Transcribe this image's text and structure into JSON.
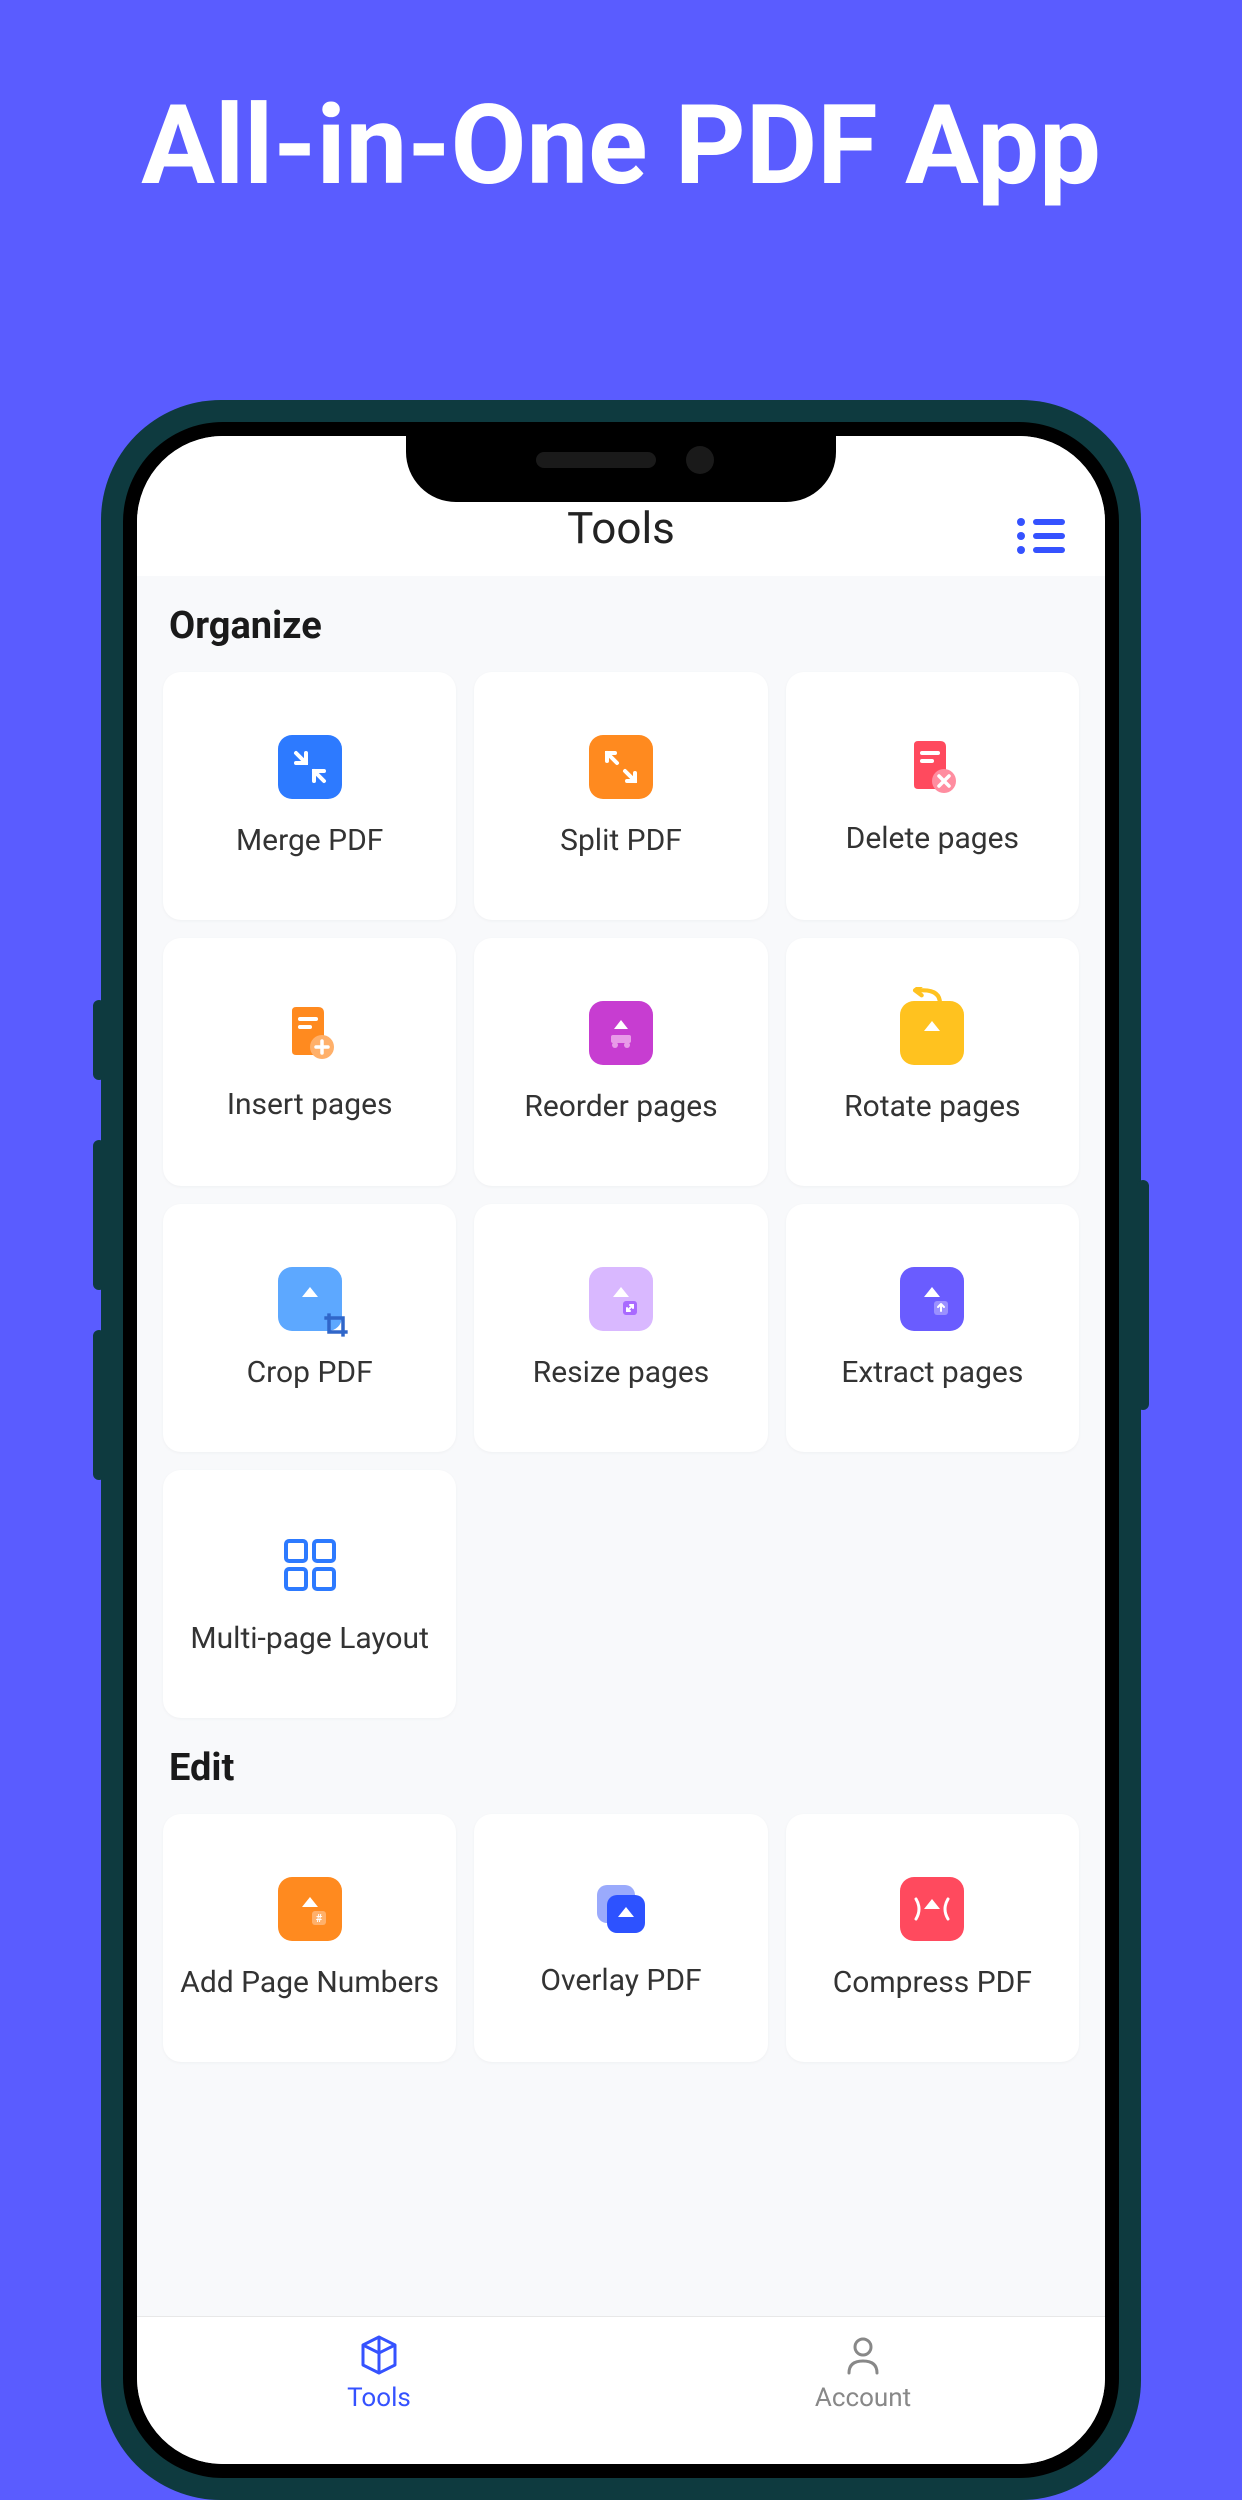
{
  "marketing": {
    "headline": "All-in-One PDF App"
  },
  "nav": {
    "title": "Tools"
  },
  "sections": {
    "organize": {
      "title": "Organize",
      "tools": [
        {
          "label": "Merge PDF",
          "icon": "merge"
        },
        {
          "label": "Split PDF",
          "icon": "split"
        },
        {
          "label": "Delete pages",
          "icon": "delete"
        },
        {
          "label": "Insert pages",
          "icon": "insert"
        },
        {
          "label": "Reorder pages",
          "icon": "reorder"
        },
        {
          "label": "Rotate pages",
          "icon": "rotate"
        },
        {
          "label": "Crop PDF",
          "icon": "crop"
        },
        {
          "label": "Resize pages",
          "icon": "resize"
        },
        {
          "label": "Extract pages",
          "icon": "extract"
        },
        {
          "label": "Multi-page Layout",
          "icon": "multipage"
        }
      ]
    },
    "edit": {
      "title": "Edit",
      "tools": [
        {
          "label": "Add Page Numbers",
          "icon": "pagenum"
        },
        {
          "label": "Overlay PDF",
          "icon": "overlay"
        },
        {
          "label": "Compress PDF",
          "icon": "compress"
        }
      ]
    }
  },
  "tabbar": {
    "tools": "Tools",
    "account": "Account"
  }
}
